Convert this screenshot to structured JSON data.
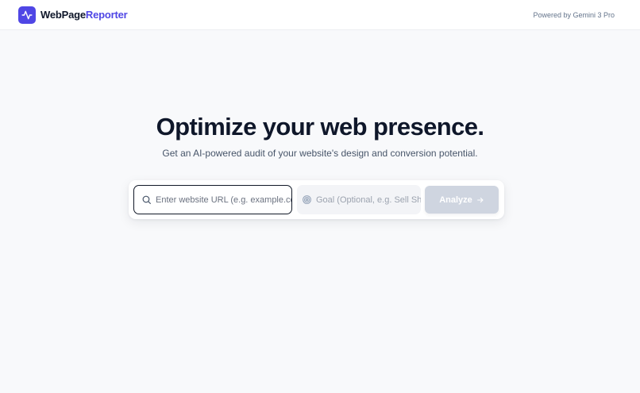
{
  "header": {
    "brand_part1": "WebPage",
    "brand_part2": "Reporter",
    "logo_icon": "activity-pulse-icon",
    "powered_by": "Powered by Gemini 3 Pro"
  },
  "hero": {
    "title": "Optimize your web presence.",
    "subtitle": "Get an AI-powered audit of your website's design and conversion potential."
  },
  "search": {
    "url_placeholder": "Enter website URL (e.g. example.com)",
    "url_value": "",
    "url_icon": "search-icon",
    "goal_placeholder": "Goal (Optional, e.g. Sell Shoes)",
    "goal_value": "",
    "goal_icon": "target-icon",
    "analyze_label": "Analyze",
    "analyze_icon": "arrow-right-icon"
  },
  "colors": {
    "accent": "#4f46e5",
    "background": "#f8f9fb",
    "button_disabled": "#cfd5e0"
  }
}
